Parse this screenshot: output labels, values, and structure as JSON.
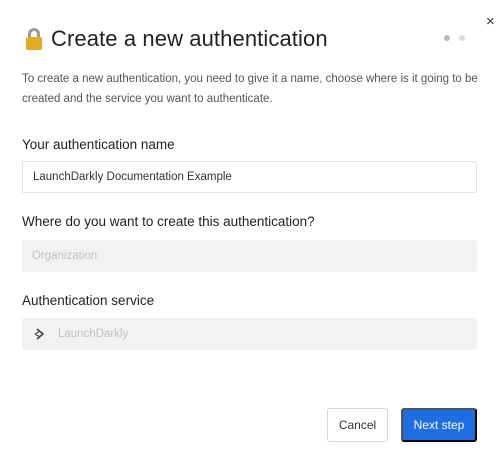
{
  "modal": {
    "close_glyph": "×",
    "title": "Create a new authentication",
    "title_icon": "lock-icon",
    "steps": {
      "total": 2,
      "current": 1
    },
    "description": "To create a new authentication, you need to give it a name, choose where is it going to be created and the service you want to authenticate."
  },
  "form": {
    "name_label": "Your authentication name",
    "name_value": "LaunchDarkly Documentation Example",
    "location_label": "Where do you want to create this authentication?",
    "location_placeholder": "Organization",
    "service_label": "Authentication service",
    "service_value": "LaunchDarkly",
    "service_icon": "launchdarkly-icon"
  },
  "actions": {
    "cancel_label": "Cancel",
    "next_label": "Next step"
  },
  "colors": {
    "primary": "#1d6de3",
    "lock": "#e3ac24",
    "disabled_field": "#f2f2f2"
  }
}
